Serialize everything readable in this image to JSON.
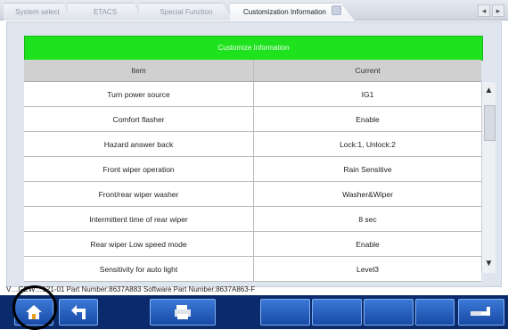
{
  "tabs": [
    {
      "label": "System select",
      "active": false
    },
    {
      "label": "ETACS",
      "active": false
    },
    {
      "label": "Special Function",
      "active": false
    },
    {
      "label": "Customization Information",
      "active": true
    }
  ],
  "header": {
    "title": "Customize Information"
  },
  "table": {
    "columns": [
      "Item",
      "Current"
    ],
    "rows": [
      [
        "Turn power source",
        "IG1"
      ],
      [
        "Comfort flasher",
        "Enable"
      ],
      [
        "Hazard answer back",
        "Lock:1, Unlock:2"
      ],
      [
        "Front wiper operation",
        "Rain Sensitive"
      ],
      [
        "Front/rear wiper washer",
        "Washer&Wiper"
      ],
      [
        "Intermittent time of rear wiper",
        "8 sec"
      ],
      [
        "Rear wiper Low speed mode",
        "Enable"
      ],
      [
        "Sensitivity for auto light",
        "Level3"
      ]
    ]
  },
  "status_line": "V…GEW…121-01 Part Number:8637A883   Software Part Number:8637A863-F",
  "bottom_bar": {
    "buttons": [
      "home-icon",
      "back-arrow-icon",
      "printer-icon",
      "",
      "",
      "",
      "",
      "",
      "enter-icon"
    ]
  },
  "colors": {
    "header_green": "#1ee21e",
    "bottom_bar": "#0a2a6b",
    "button_blue": "#2a63c4"
  }
}
